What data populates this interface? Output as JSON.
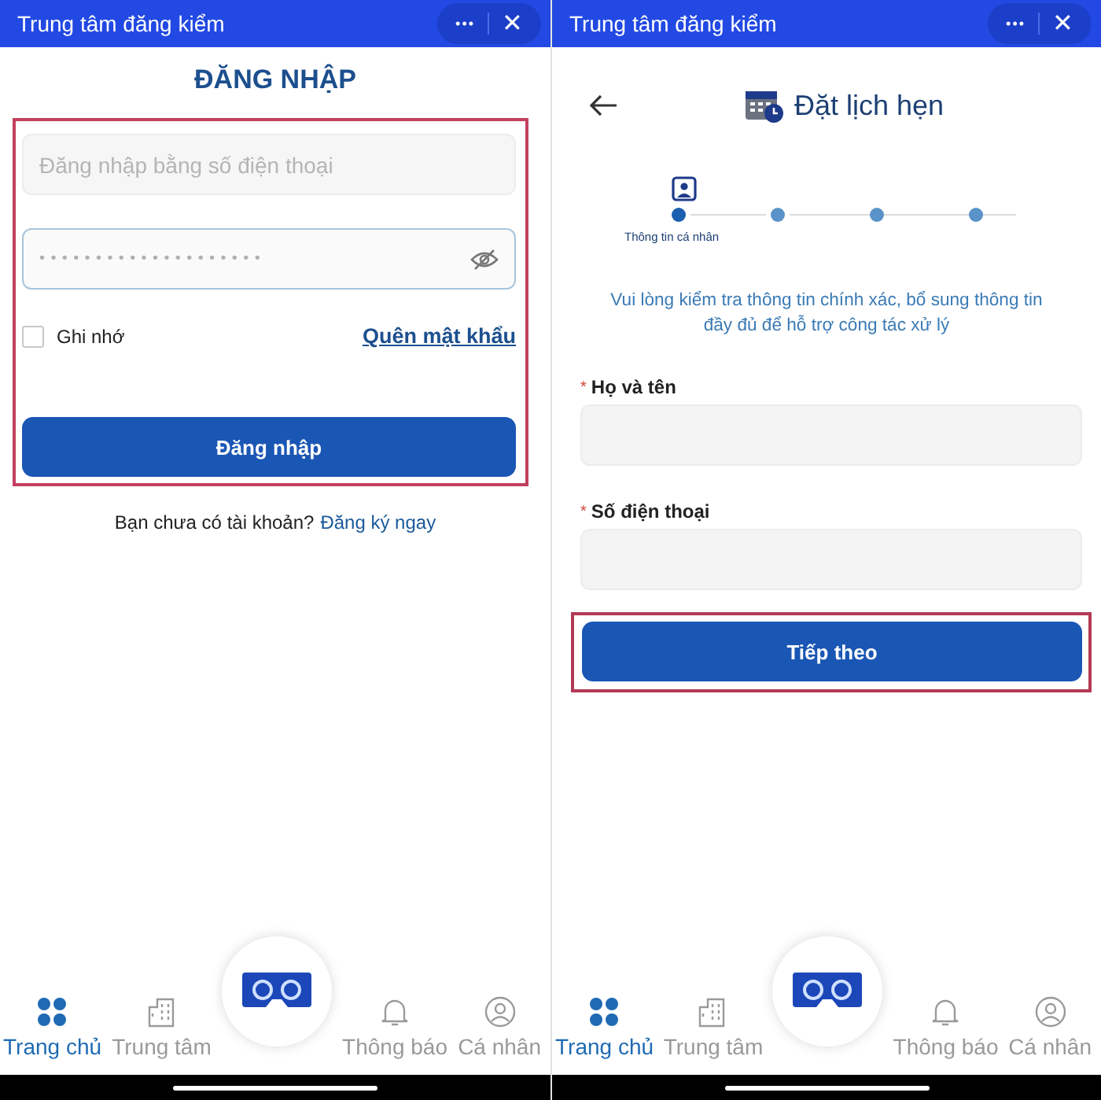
{
  "screens": [
    {
      "kind": "login",
      "header": {
        "title": "Trung tâm đăng kiểm",
        "menu": "•••",
        "close": "✕"
      },
      "title": "ĐĂNG NHẬP",
      "form": {
        "highlighted": true,
        "phone_placeholder": "Đăng nhập bằng số điện thoại",
        "password_value": "••••••••••••••••••••",
        "remember": {
          "label": "Ghi nhớ",
          "checked": false
        },
        "forgot": "Quên mật khẩu",
        "submit": "Đăng nhập"
      },
      "signup": {
        "text": "Bạn chưa có tài khoản?",
        "link": "Đăng ký ngay"
      },
      "nav": [
        {
          "kind": "grid",
          "label": "Trang chủ",
          "selected": true
        },
        {
          "kind": "building",
          "label": "Trung tâm",
          "selected": false
        },
        {
          "kind": "center"
        },
        {
          "kind": "bell",
          "label": "Thông báo",
          "selected": false
        },
        {
          "kind": "user",
          "label": "Cá nhân",
          "selected": false
        }
      ]
    },
    {
      "kind": "booking",
      "header": {
        "title": "Trung tâm đăng kiểm",
        "menu": "•••",
        "close": "✕"
      },
      "title": "Đặt lịch hẹn",
      "steps": [
        {
          "label": "Thông tin cá nhân",
          "selected": true
        },
        {
          "selected": false
        },
        {
          "selected": false
        },
        {
          "selected": false
        }
      ],
      "info": "Vui lòng kiểm tra thông tin chính xác, bổ sung thông tin đầy đủ để hỗ trợ công tác xử lý",
      "fields": [
        {
          "label": "Họ và tên",
          "required_mark": "*"
        },
        {
          "label": "Số điện thoại",
          "required_mark": "*"
        }
      ],
      "next": {
        "label": "Tiếp theo",
        "highlighted": true
      },
      "nav": [
        {
          "kind": "grid",
          "label": "Trang chủ",
          "selected": true
        },
        {
          "kind": "building",
          "label": "Trung tâm",
          "selected": false
        },
        {
          "kind": "center"
        },
        {
          "kind": "bell",
          "label": "Thông báo",
          "selected": false
        },
        {
          "kind": "user",
          "label": "Cá nhân",
          "selected": false
        }
      ]
    }
  ]
}
